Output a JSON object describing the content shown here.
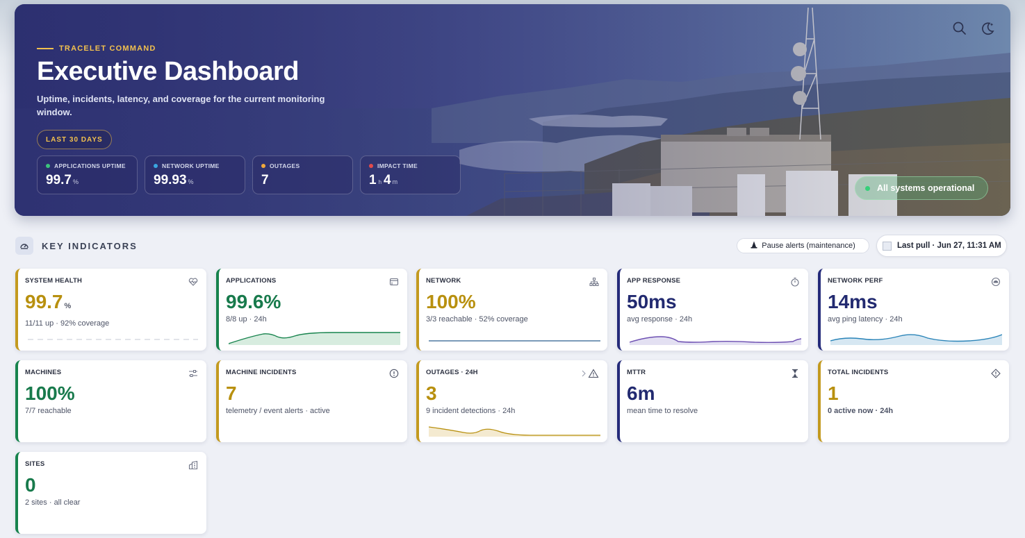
{
  "hero": {
    "eyebrow": "TRACELET COMMAND",
    "title": "Executive Dashboard",
    "subtitle": "Uptime, incidents, latency, and coverage for the current monitoring window.",
    "range": "LAST 30 DAYS",
    "status": "All systems operational",
    "icons": [
      "search-icon",
      "moon-icon"
    ],
    "stats": [
      {
        "label": "APPLICATIONS UPTIME",
        "value": "99.7",
        "unit": "%",
        "dot": "#3cc47c"
      },
      {
        "label": "NETWORK UPTIME",
        "value": "99.93",
        "unit": "%",
        "dot": "#3aa6e0"
      },
      {
        "label": "OUTAGES",
        "value": "7",
        "unit": "",
        "dot": "#f2a93b"
      },
      {
        "label": "IMPACT TIME",
        "hours": "1",
        "hours_unit": "h",
        "minutes": "4",
        "minutes_unit": "m",
        "dot": "#e24b4b"
      }
    ]
  },
  "indicators": {
    "title": "KEY INDICATORS",
    "pause_button": "Pause alerts (maintenance)",
    "last_pull": "Last pull · Jun 27, 11:31 AM"
  },
  "cards": [
    {
      "title": "SYSTEM HEALTH",
      "value": "99.7",
      "unit": "%",
      "sub": "11/11 up · 92% coverage",
      "icon": "heart-pulse-icon"
    },
    {
      "title": "APPLICATIONS",
      "value": "99.6%",
      "sub": "8/8 up · 24h",
      "icon": "window-icon"
    },
    {
      "title": "NETWORK",
      "value": "100%",
      "sub": "3/3 reachable · 52% coverage",
      "icon": "network-icon"
    },
    {
      "title": "APP RESPONSE",
      "value": "50ms",
      "sub": "avg response · 24h",
      "icon": "stopwatch-icon"
    },
    {
      "title": "NETWORK PERF",
      "value": "14ms",
      "sub": "avg ping latency · 24h",
      "icon": "gauge-icon"
    },
    {
      "title": "MACHINES",
      "value": "100%",
      "sub": "7/7 reachable",
      "icon": "sliders-icon"
    },
    {
      "title": "MACHINE INCIDENTS",
      "value": "7",
      "sub": "telemetry / event alerts · active",
      "icon": "alert-circle-icon"
    },
    {
      "title": "OUTAGES · 24H",
      "value": "3",
      "sub": "9 incident detections · 24h",
      "icon": "warning-icon"
    },
    {
      "title": "MTTR",
      "value": "6m",
      "sub": "mean time to resolve",
      "icon": "hourglass-icon"
    },
    {
      "title": "TOTAL INCIDENTS",
      "value": "1",
      "sub": "0 active now · 24h",
      "icon": "diamond-alert-icon"
    },
    {
      "title": "SITES",
      "value": "0",
      "sub": "2 sites · all clear",
      "icon": "building-icon"
    }
  ],
  "colors": {
    "gold": "#b8900f",
    "green": "#187a4c",
    "navy": "#222a70"
  }
}
